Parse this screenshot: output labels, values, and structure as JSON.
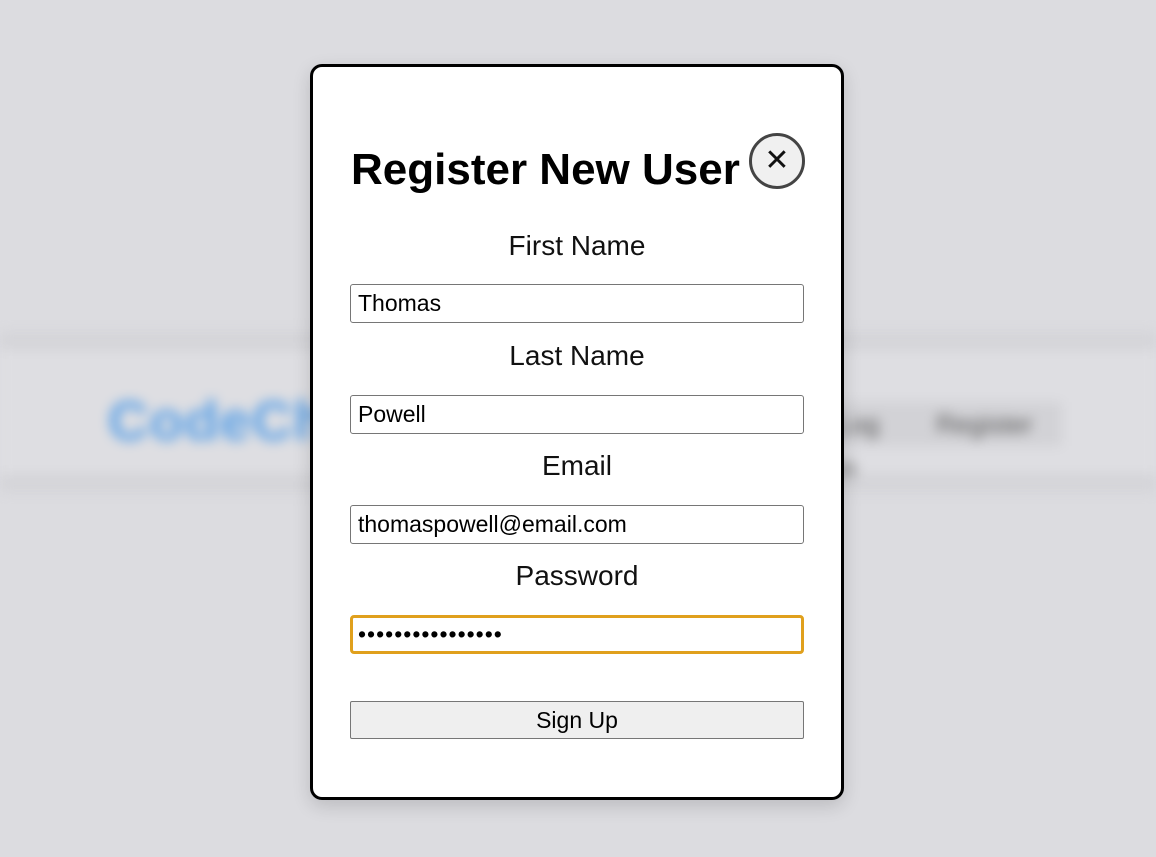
{
  "background": {
    "logo_text": "CodeCh",
    "nav": {
      "login_label": "Log in",
      "register_label": "Register"
    }
  },
  "modal": {
    "title": "Register New User",
    "close_icon": "close-icon",
    "close_glyph": "✕",
    "fields": {
      "first_name": {
        "label": "First Name",
        "value": "Thomas"
      },
      "last_name": {
        "label": "Last Name",
        "value": "Powell"
      },
      "email": {
        "label": "Email",
        "value": "thomaspowell@email.com"
      },
      "password": {
        "label": "Password",
        "value": "••••••••••••••••"
      }
    },
    "submit_label": "Sign Up"
  },
  "colors": {
    "overlay": "#dcdce0",
    "focus_ring": "#e0a01c",
    "logo": "#5aa0e6"
  }
}
